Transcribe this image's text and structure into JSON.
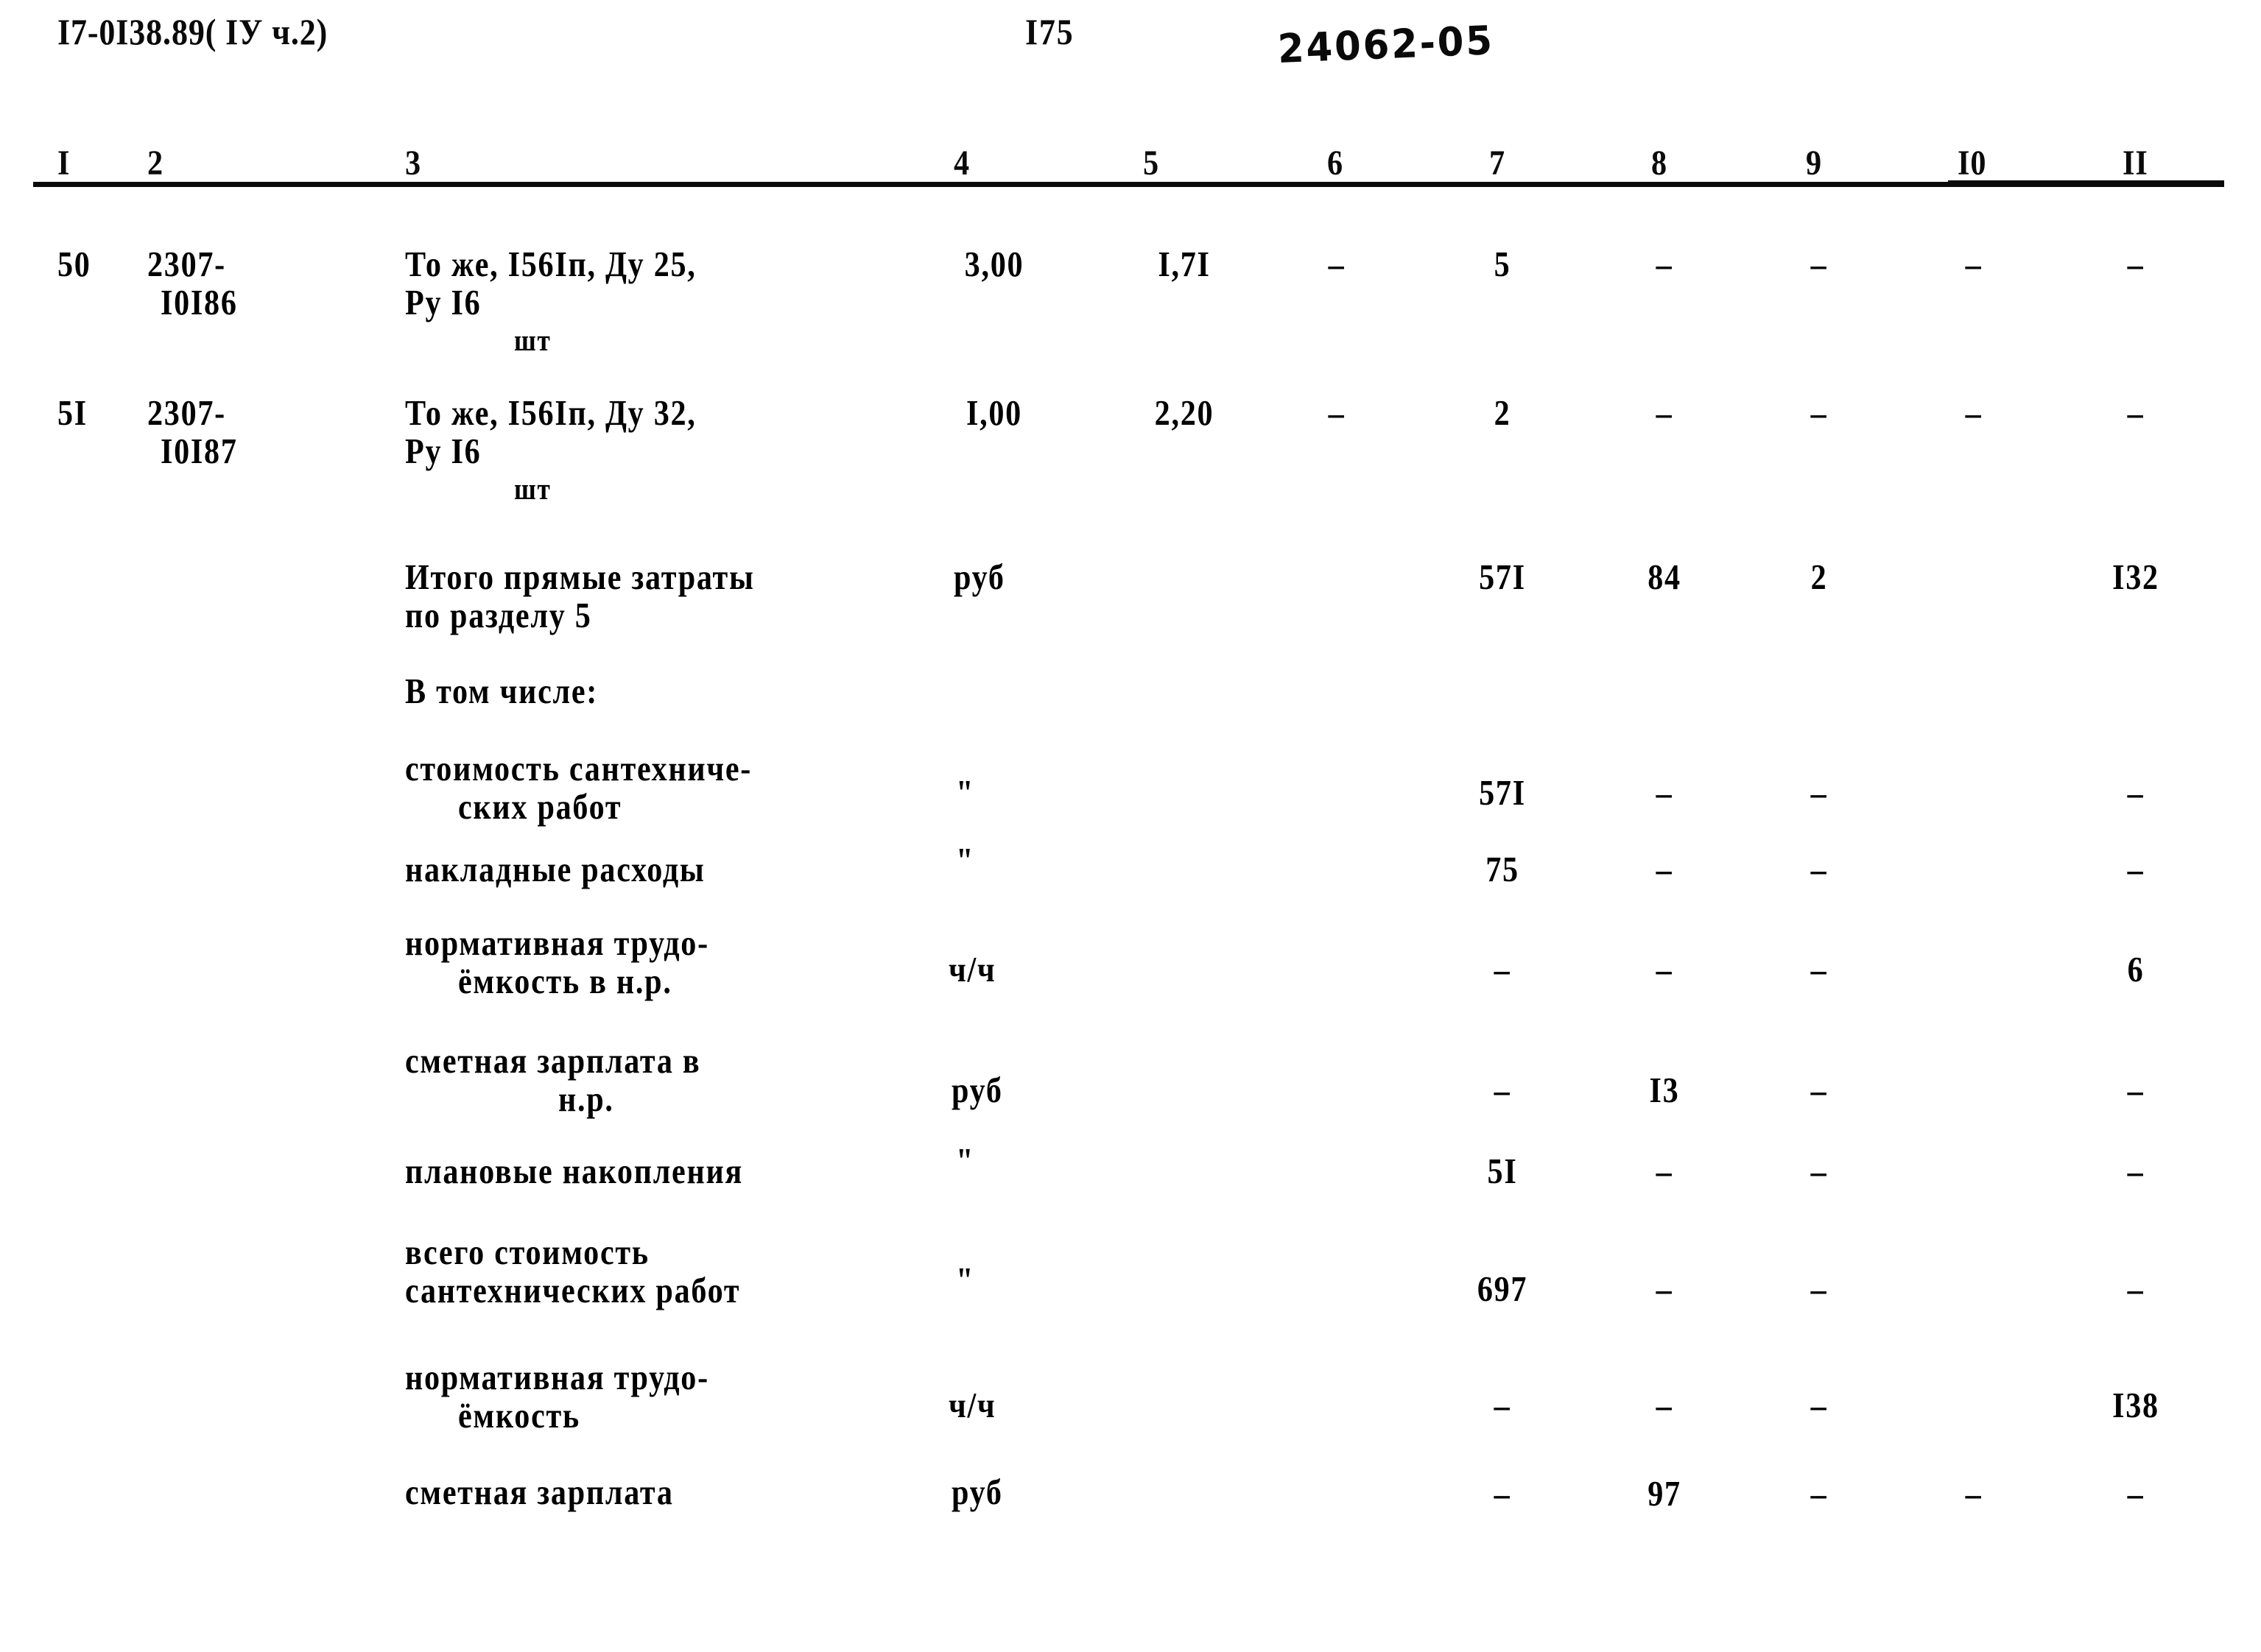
{
  "header": {
    "doc_code": "I7-0I38.89( IУ ч.2)",
    "page_number": "I75",
    "handwritten_note": "24062-05"
  },
  "table": {
    "column_headers": [
      "I",
      "2",
      "3",
      "4",
      "5",
      "6",
      "7",
      "8",
      "9",
      "I0",
      "II"
    ],
    "rows": [
      {
        "num": "50",
        "code_line1": "2307-",
        "code_line2": "I0I86",
        "desc_line1": "То же, I56Iп, Ду 25,",
        "desc_line2": "Ру I6",
        "unit_sub": "шт",
        "c4": "3,00",
        "c5": "I,7I",
        "c6": "–",
        "c7": "5",
        "c8": "–",
        "c9": "–",
        "c10": "–",
        "c11": "–"
      },
      {
        "num": "5I",
        "code_line1": "2307-",
        "code_line2": "I0I87",
        "desc_line1": "То же, I56Iп, Ду 32,",
        "desc_line2": "Ру I6",
        "unit_sub": "шт",
        "c4": "I,00",
        "c5": "2,20",
        "c6": "–",
        "c7": "2",
        "c8": "–",
        "c9": "–",
        "c10": "–",
        "c11": "–"
      }
    ],
    "summary_rows": [
      {
        "desc_line1": "Итого прямые затраты",
        "desc_line2": "по разделу 5",
        "unit": "руб",
        "c7": "57I",
        "c8": "84",
        "c9": "2",
        "c10": "",
        "c11": "I32"
      },
      {
        "desc_line1": "В том числе:",
        "desc_line2": "",
        "unit": "",
        "c7": "",
        "c8": "",
        "c9": "",
        "c10": "",
        "c11": ""
      },
      {
        "desc_line1": "стоимость сантехниче-",
        "desc_line2": "ских работ",
        "unit": "\"",
        "c7": "57I",
        "c8": "–",
        "c9": "–",
        "c10": "",
        "c11": "–"
      },
      {
        "desc_line1": "накладные расходы",
        "desc_line2": "",
        "unit": "\"",
        "c7": "75",
        "c8": "–",
        "c9": "–",
        "c10": "",
        "c11": "–"
      },
      {
        "desc_line1": "нормативная трудо-",
        "desc_line2": "ёмкость в н.р.",
        "unit": "ч/ч",
        "c7": "–",
        "c8": "–",
        "c9": "–",
        "c10": "",
        "c11": "6"
      },
      {
        "desc_line1": "сметная зарплата в",
        "desc_line2": "н.р.",
        "unit": "руб",
        "c7": "–",
        "c8": "I3",
        "c9": "–",
        "c10": "",
        "c11": "–"
      },
      {
        "desc_line1": "плановые накопления",
        "desc_line2": "",
        "unit": "\"",
        "c7": "5I",
        "c8": "–",
        "c9": "–",
        "c10": "",
        "c11": "–"
      },
      {
        "desc_line1": "всего стоимость",
        "desc_line2": "сантехнических работ",
        "unit": "\"",
        "c7": "697",
        "c8": "–",
        "c9": "–",
        "c10": "",
        "c11": "–"
      },
      {
        "desc_line1": "нормативная трудо-",
        "desc_line2": "ёмкость",
        "unit": "ч/ч",
        "c7": "–",
        "c8": "–",
        "c9": "–",
        "c10": "",
        "c11": "I38"
      },
      {
        "desc_line1": "сметная зарплата",
        "desc_line2": "",
        "unit": "руб",
        "c7": "–",
        "c8": "97",
        "c9": "–",
        "c10": "–",
        "c11": "–"
      }
    ]
  }
}
